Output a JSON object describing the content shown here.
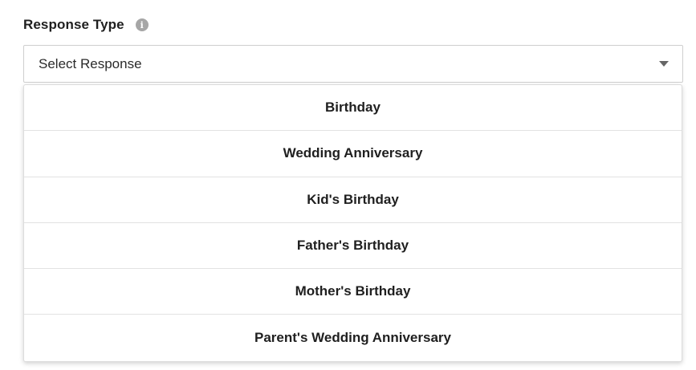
{
  "field": {
    "label": "Response Type",
    "info_icon": "info-icon",
    "info_glyph": "i"
  },
  "select": {
    "value": "Select Response",
    "caret_icon": "caret-down-icon"
  },
  "dropdown": {
    "options": [
      {
        "label": "Birthday"
      },
      {
        "label": "Wedding Anniversary"
      },
      {
        "label": "Kid's Birthday"
      },
      {
        "label": "Father's Birthday"
      },
      {
        "label": "Mother's Birthday"
      },
      {
        "label": "Parent's Wedding Anniversary"
      }
    ]
  }
}
